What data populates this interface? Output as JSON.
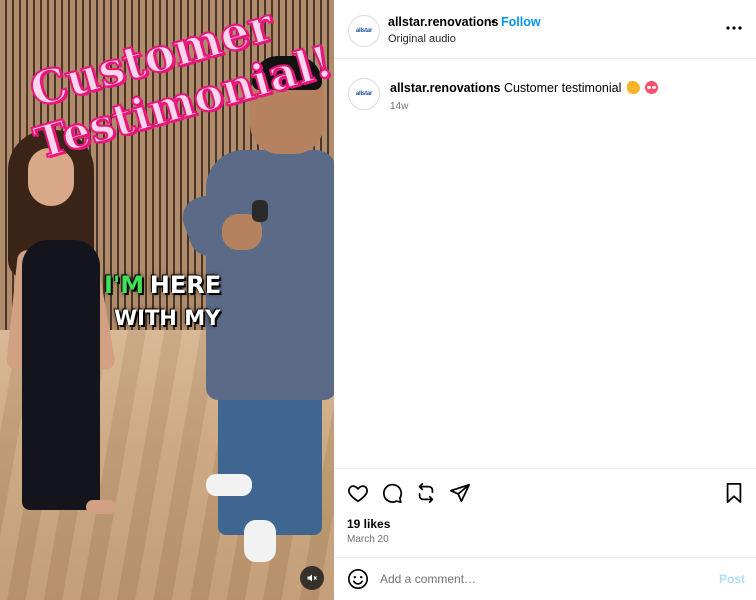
{
  "video": {
    "overlay_line1": "Customer",
    "overlay_line2": "Testimonial!",
    "caption_green": "I'M",
    "caption_white": "HERE",
    "caption_line2": "WITH MY",
    "mute_icon": "speaker-muted-icon"
  },
  "header": {
    "avatar_text": "allstar",
    "username": "allstar.renovations",
    "separator": "•",
    "follow_label": "Follow",
    "audio_label": "Original audio",
    "more_icon": "more-options-icon"
  },
  "post_caption": {
    "username": "allstar.renovations",
    "text": "Customer testimonial",
    "emojis": [
      "flexed-biceps-emoji",
      "heart-eyes-emoji"
    ],
    "time": "14w"
  },
  "actions": {
    "icons": [
      "heart-icon",
      "comment-icon",
      "repost-icon",
      "share-icon",
      "bookmark-icon"
    ],
    "likes": "19 likes",
    "date": "March 20"
  },
  "comment_box": {
    "placeholder": "Add a comment…",
    "post_label": "Post"
  },
  "colors": {
    "accent": "#0095f6",
    "post_disabled": "#b3dbff",
    "overlay_pink": "#e8177c",
    "caption_green": "#3fe05a"
  }
}
